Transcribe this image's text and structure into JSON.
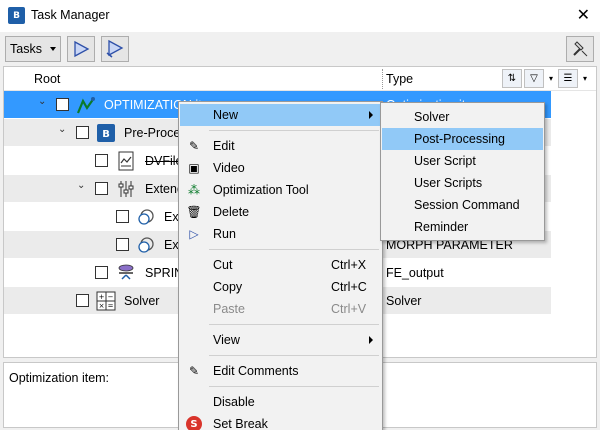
{
  "window": {
    "title": "Task Manager",
    "close": "✕"
  },
  "toolbar": {
    "tasks_label": "Tasks"
  },
  "columns": {
    "root": "Root",
    "type": "Type"
  },
  "tree": [
    {
      "label": "OPTIMIZATION item",
      "type": "Optimization item"
    },
    {
      "label": "Pre-Processing",
      "type": ""
    },
    {
      "label": "DVFile",
      "type": ""
    },
    {
      "label": "Extended Range",
      "type": ""
    },
    {
      "label": "Ex",
      "type": ""
    },
    {
      "label": "Ex",
      "type": "MORPH PARAMETER"
    },
    {
      "label": "SPRING",
      "type": "FE_output"
    },
    {
      "label": "Solver",
      "type": "Solver"
    }
  ],
  "description": "Optimization item:",
  "context_menu": {
    "new": "New",
    "edit": "Edit",
    "video": "Video",
    "optimization_tool": "Optimization Tool",
    "delete": "Delete",
    "run": "Run",
    "cut": "Cut",
    "cut_key": "Ctrl+X",
    "copy": "Copy",
    "copy_key": "Ctrl+C",
    "paste": "Paste",
    "paste_key": "Ctrl+V",
    "view": "View",
    "edit_comments": "Edit Comments",
    "disable": "Disable",
    "set_break": "Set Break"
  },
  "submenu": [
    "Solver",
    "Post-Processing",
    "User Script",
    "User Scripts",
    "Session Command",
    "Reminder"
  ],
  "colors": {
    "selection": "#3399ff",
    "menu_highlight": "#91c9f7",
    "accent": "#1f5fa8"
  }
}
